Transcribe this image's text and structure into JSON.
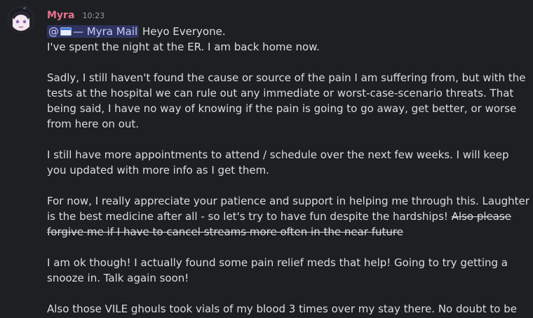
{
  "message": {
    "author": "Myra",
    "timestamp": "10:23",
    "mention": {
      "prefix": "@",
      "icon": "mail-icon",
      "label": "— Myra Mail"
    },
    "first_line_after_mention": " Heyo Everyone.",
    "p1": "I've spent the night at the ER. I am back home now.",
    "p2": "Sadly, I still haven't found the cause or source of the pain I am suffering from, but with the tests at the hospital we can rule out any immediate or worst-case-scenario threats. That being said, I have no way of knowing if the pain is going to go away, get better, or worse from here on out.",
    "p3": "I still have more appointments to attend / schedule over the next few weeks. I will keep you updated with more info as I get them.",
    "p4": "For now, I really appreciate your patience and support in helping me through this. Laughter is the best medicine after all - so let's try to have fun despite the hardships! ",
    "p4_strike": "Also please forgive me if I have to cancel streams more often in the near future",
    "p5": "I am ok though! I actually found some pain relief meds that help! Going to try getting a snooze in. Talk again soon!",
    "p6": "Also those VILE ghouls took vials of my blood 3 times over my stay there. No doubt to be used for nefarious rituals or divination spells. Will also report on any findings regarding that"
  },
  "colors": {
    "background": "#1e1f22",
    "username": "#e8738f",
    "mention_bg": "#3b3f74",
    "text": "#dbdee1",
    "timestamp": "#949ba4"
  }
}
